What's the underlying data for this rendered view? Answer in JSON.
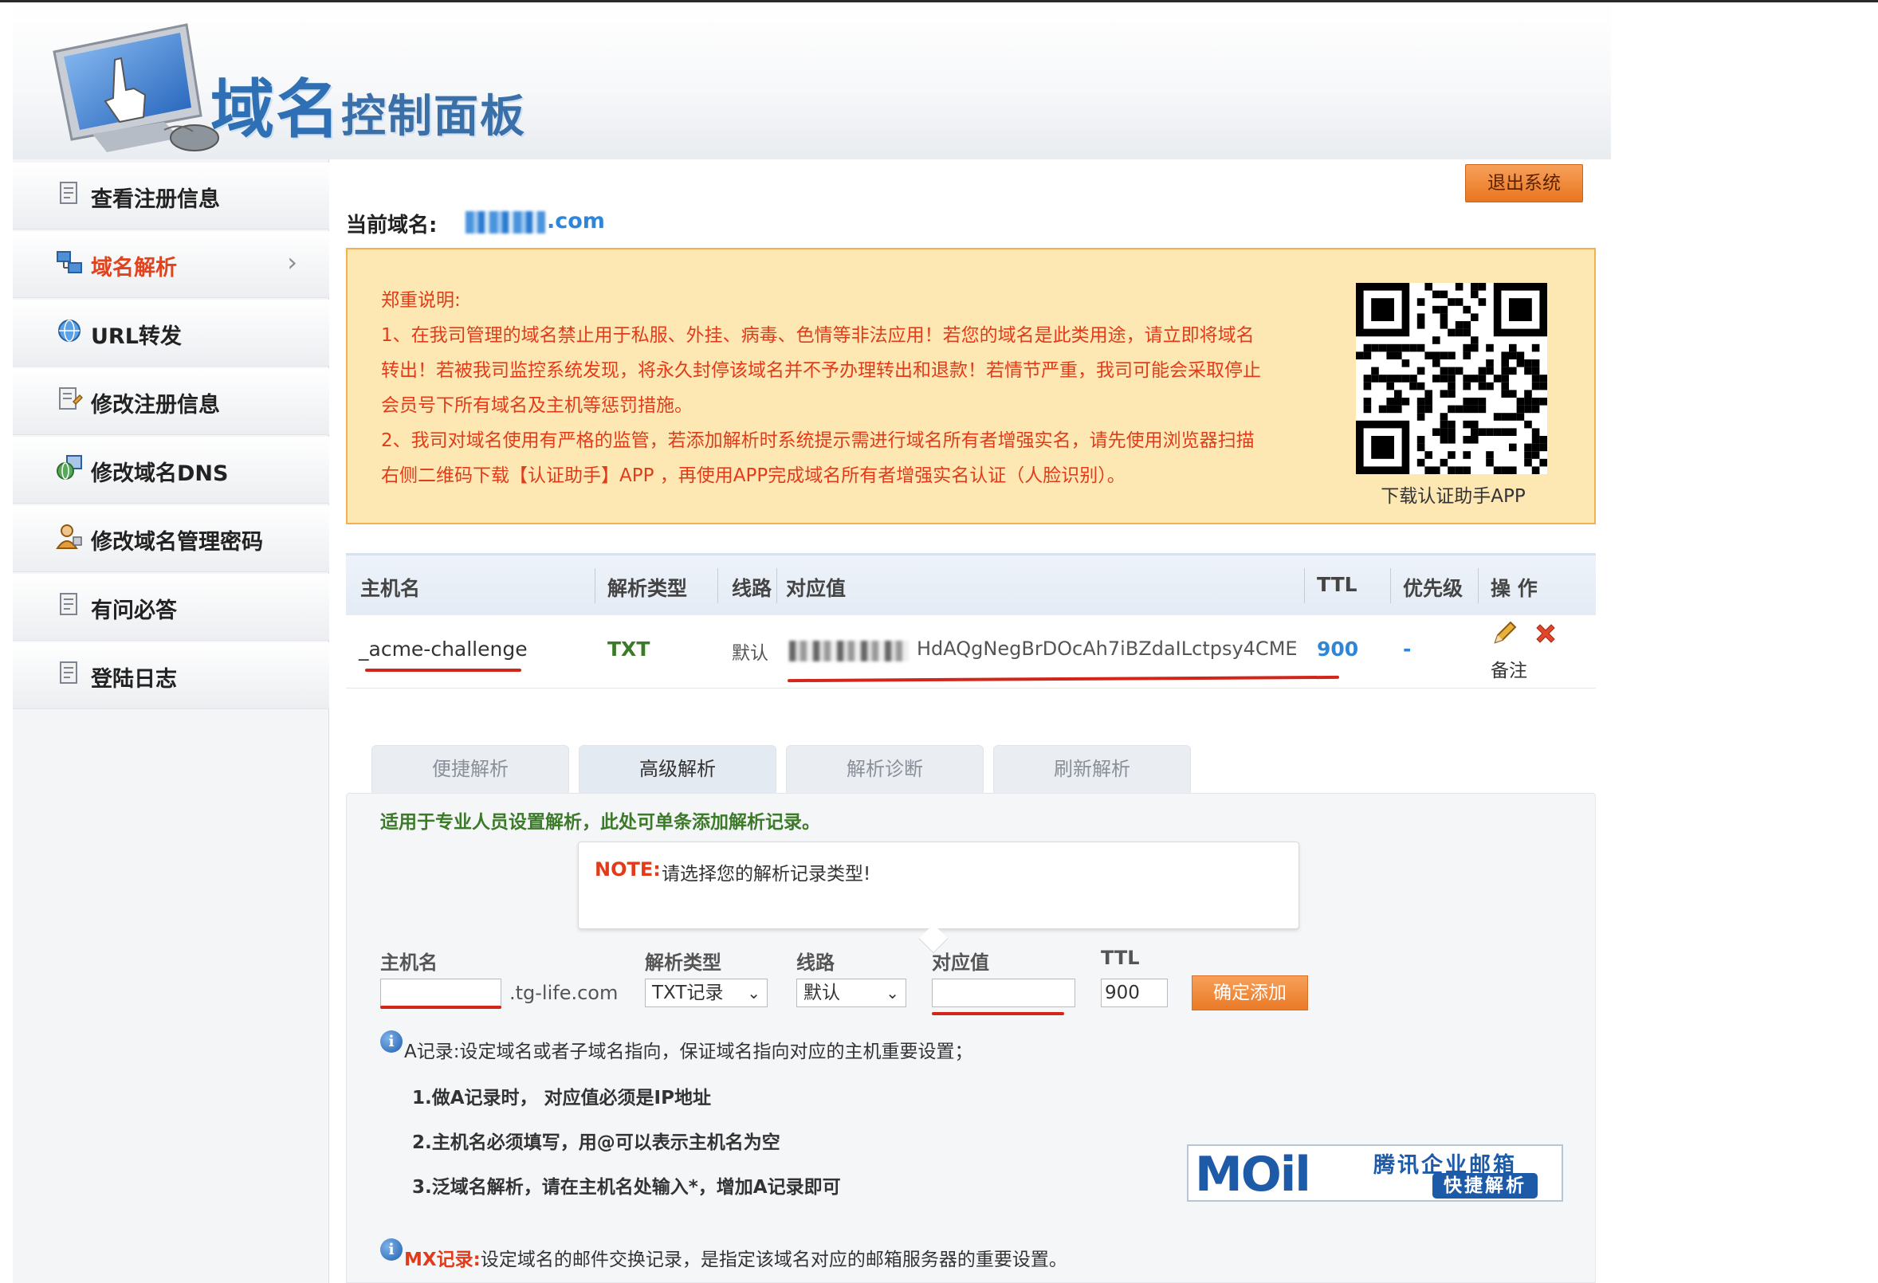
{
  "header": {
    "title_main": "域名",
    "title_sub": "控制面板"
  },
  "sidebar": {
    "items": [
      {
        "label": "查看注册信息",
        "icon": "document-icon",
        "active": false
      },
      {
        "label": "域名解析",
        "icon": "network-icon",
        "active": true
      },
      {
        "label": "URL转发",
        "icon": "globe-icon",
        "active": false
      },
      {
        "label": "修改注册信息",
        "icon": "edit-document-icon",
        "active": false
      },
      {
        "label": "修改域名DNS",
        "icon": "dns-globe-icon",
        "active": false
      },
      {
        "label": "修改域名管理密码",
        "icon": "user-key-icon",
        "active": false
      },
      {
        "label": "有问必答",
        "icon": "document-icon",
        "active": false
      },
      {
        "label": "登陆日志",
        "icon": "document-icon",
        "active": false
      }
    ]
  },
  "topbar": {
    "logout_label": "退出系统"
  },
  "current_domain": {
    "label": "当前域名:",
    "value": ".com"
  },
  "notice": {
    "lines": [
      "郑重说明:",
      "1、在我司管理的域名禁止用于私服、外挂、病毒、色情等非法应用！若您的域名是此类用途，请立即将域名",
      "转出！若被我司监控系统发现，将永久封停该域名并不予办理转出和退款！若情节严重，我司可能会采取停止",
      "会员号下所有域名及主机等惩罚措施。",
      "2、我司对域名使用有严格的监管，若添加解析时系统提示需进行域名所有者增强实名，请先使用浏览器扫描",
      "右侧二维码下载【认证助手】APP ，再使用APP完成域名所有者增强实名认证（人脸识别）。"
    ],
    "qr_label": "下载认证助手APP"
  },
  "table": {
    "headers": [
      "主机名",
      "解析类型",
      "线路",
      "对应值",
      "TTL",
      "优先级",
      "操 作"
    ],
    "rows": [
      {
        "host": "_acme-challenge",
        "type": "TXT",
        "line": "默认",
        "value": "HdAQgNegBrDOcAh7iBZdaILctpsy4CME",
        "ttl": "900",
        "priority": "-",
        "note": "备注"
      }
    ]
  },
  "tabs": [
    {
      "label": "便捷解析",
      "active": false
    },
    {
      "label": "高级解析",
      "active": true
    },
    {
      "label": "解析诊断",
      "active": false
    },
    {
      "label": "刷新解析",
      "active": false
    }
  ],
  "form": {
    "intro": "适用于专业人员设置解析，此处可单条添加解析记录。",
    "note_label": "NOTE:",
    "note_text": "请选择您的解析记录类型!",
    "host_label": "主机名",
    "host_value": "",
    "host_suffix": ".tg-life.com",
    "type_label": "解析类型",
    "type_value": "TXT记录",
    "line_label": "线路",
    "line_value": "默认",
    "value_label": "对应值",
    "value_value": "",
    "ttl_label": "TTL",
    "ttl_value": "900",
    "submit_label": "确定添加"
  },
  "help": {
    "a_record": "A记录:设定域名或者子域名指向，保证域名指向对应的主机重要设置；",
    "a_items": [
      "1.做A记录时， 对应值必须是IP地址",
      "2.主机名必须填写，用@可以表示主机名为空",
      "3.泛域名解析，请在主机名处输入*，增加A记录即可"
    ],
    "mx_label": "MX记录:",
    "mx_text": "设定域名的邮件交换记录，是指定该域名对应的邮箱服务器的重要设置。"
  },
  "banner": {
    "logo": "MOil",
    "title": "腾讯企业邮箱",
    "subtitle": "快捷解析"
  },
  "colors": {
    "accent_red": "#e23b1a",
    "link_blue": "#2f86d8",
    "green": "#3c7a2a",
    "orange_button": "#ea7a26"
  }
}
